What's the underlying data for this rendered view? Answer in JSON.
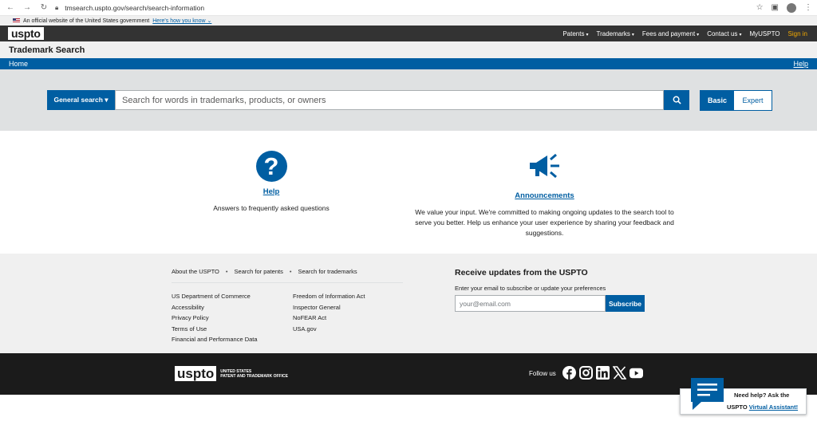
{
  "browser": {
    "url": "tmsearch.uspto.gov/search/search-information"
  },
  "gov_banner": {
    "text": "An official website of the United States government",
    "link": "Here's how you know"
  },
  "top_nav": {
    "logo": "uspto",
    "items": [
      {
        "label": "Patents",
        "caret": "▾"
      },
      {
        "label": "Trademarks",
        "caret": "▾"
      },
      {
        "label": "Fees and payment",
        "caret": "▾"
      },
      {
        "label": "Contact us",
        "caret": "▾"
      },
      {
        "label": "MyUSPTO"
      }
    ],
    "sign_in": "Sign in"
  },
  "app_title": "Trademark Search",
  "breadcrumb": {
    "home": "Home",
    "help": "Help"
  },
  "search": {
    "type_button": "General search ▾",
    "placeholder": "Search for words in trademarks, products, or owners",
    "mode_basic": "Basic",
    "mode_expert": "Expert"
  },
  "cards": {
    "help": {
      "title": "Help",
      "text": "Answers to frequently asked questions",
      "icon": "question-icon"
    },
    "announcements": {
      "title": "Announcements",
      "text": "We value your input. We're committed to making ongoing updates to the search tool to serve you better. Help us enhance your user experience by sharing your feedback and suggestions.",
      "icon": "megaphone-icon"
    }
  },
  "footer": {
    "top_links": [
      "About the USPTO",
      "Search for patents",
      "Search for trademarks"
    ],
    "col1": [
      "US Department of Commerce",
      "Accessibility",
      "Privacy Policy",
      "Terms of Use",
      "Financial and Performance Data"
    ],
    "col2": [
      "Freedom of Information Act",
      "Inspector General",
      "NoFEAR Act",
      "USA.gov"
    ],
    "updates_title": "Receive updates from the USPTO",
    "updates_sub": "Enter your email to subscribe or update your preferences",
    "email_placeholder": "your@email.com",
    "subscribe": "Subscribe",
    "logo": "uspto",
    "logo_line1": "UNITED STATES",
    "logo_line2": "PATENT AND TRADEMARK OFFICE",
    "follow": "Follow us",
    "social_icons": [
      "facebook-icon",
      "instagram-icon",
      "linkedin-icon",
      "x-icon",
      "youtube-icon"
    ]
  },
  "assistant": {
    "line1": "Need help? Ask the",
    "line2_prefix": "USPTO ",
    "line2_link": "Virtual Assistant!"
  },
  "colors": {
    "primary": "#005ea2",
    "dark": "#1b1b1b",
    "nav": "#333333",
    "gold": "#f2a900"
  }
}
